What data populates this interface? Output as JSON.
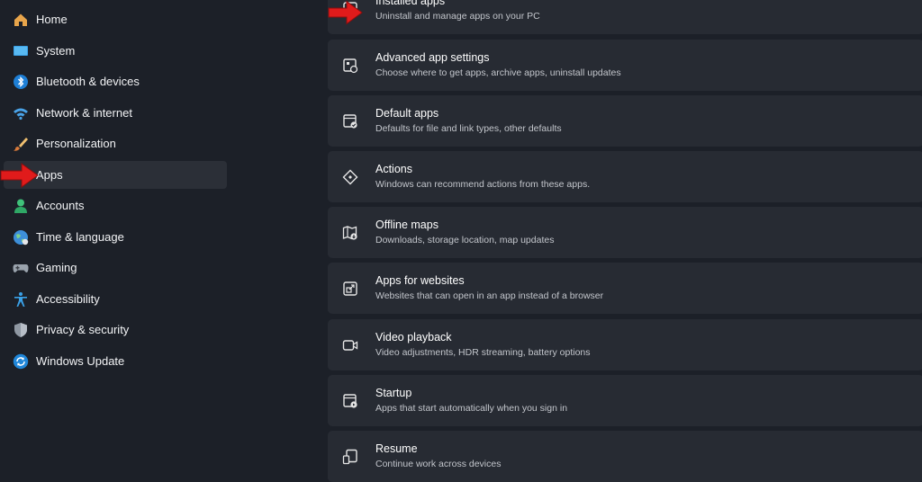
{
  "sidebar": {
    "items": [
      {
        "label": "Home",
        "icon": "home-icon"
      },
      {
        "label": "System",
        "icon": "system-icon"
      },
      {
        "label": "Bluetooth & devices",
        "icon": "bluetooth-icon"
      },
      {
        "label": "Network & internet",
        "icon": "wifi-icon"
      },
      {
        "label": "Personalization",
        "icon": "brush-icon"
      },
      {
        "label": "Apps",
        "icon": "apps-icon",
        "selected": true
      },
      {
        "label": "Accounts",
        "icon": "person-icon"
      },
      {
        "label": "Time & language",
        "icon": "globe-icon"
      },
      {
        "label": "Gaming",
        "icon": "gamepad-icon"
      },
      {
        "label": "Accessibility",
        "icon": "accessibility-icon"
      },
      {
        "label": "Privacy & security",
        "icon": "shield-icon"
      },
      {
        "label": "Windows Update",
        "icon": "update-icon"
      }
    ]
  },
  "cards": [
    {
      "title": "Installed apps",
      "subtitle": "Uninstall and manage apps on your PC",
      "icon": "installed-apps-icon"
    },
    {
      "title": "Advanced app settings",
      "subtitle": "Choose where to get apps, archive apps, uninstall updates",
      "icon": "advanced-settings-icon"
    },
    {
      "title": "Default apps",
      "subtitle": "Defaults for file and link types, other defaults",
      "icon": "default-apps-icon"
    },
    {
      "title": "Actions",
      "subtitle": "Windows can recommend actions from these apps.",
      "icon": "actions-icon"
    },
    {
      "title": "Offline maps",
      "subtitle": "Downloads, storage location, map updates",
      "icon": "map-icon"
    },
    {
      "title": "Apps for websites",
      "subtitle": "Websites that can open in an app instead of a browser",
      "icon": "open-external-icon"
    },
    {
      "title": "Video playback",
      "subtitle": "Video adjustments, HDR streaming, battery options",
      "icon": "video-icon"
    },
    {
      "title": "Startup",
      "subtitle": "Apps that start automatically when you sign in",
      "icon": "startup-icon"
    },
    {
      "title": "Resume",
      "subtitle": "Continue work across devices",
      "icon": "resume-icon"
    }
  ],
  "colors": {
    "background": "#1c2028",
    "card": "#272b33",
    "selected": "#2b2f37",
    "annotation_arrow": "#e01b1b"
  }
}
